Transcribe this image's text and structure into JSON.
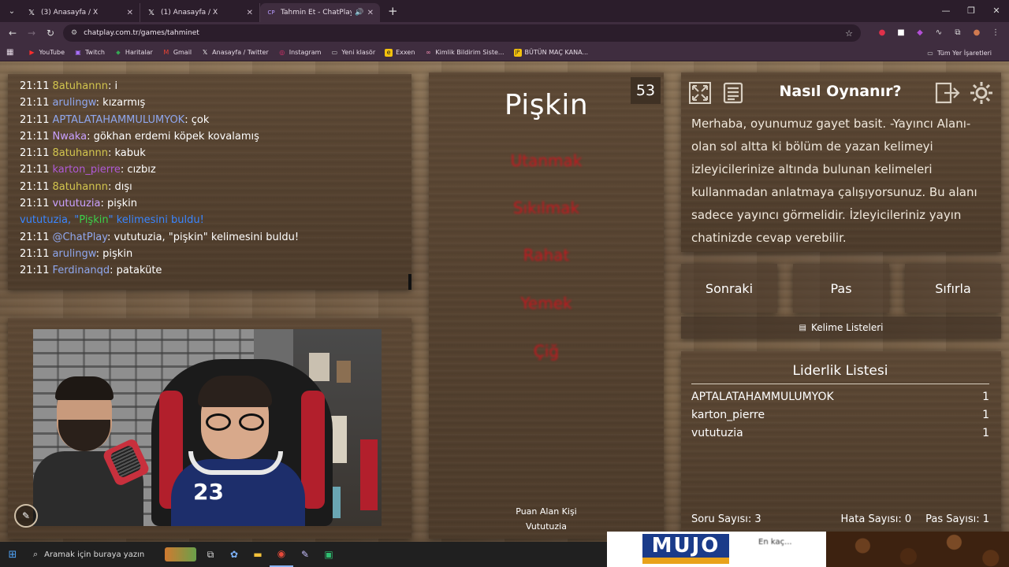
{
  "browser": {
    "tabs": [
      {
        "title": "(3) Anasayfa / X",
        "favicon": "x-logo-icon",
        "active": false
      },
      {
        "title": "(1) Anasayfa / X",
        "favicon": "x-logo-icon",
        "active": false
      },
      {
        "title": "Tahmin Et - ChatPlay",
        "favicon": "chatplay-icon",
        "active": true
      }
    ],
    "url": "chatplay.com.tr/games/tahminet",
    "bookmarks": [
      "YouTube",
      "Twitch",
      "Haritalar",
      "Gmail",
      "Anasayfa / Twitter",
      "Instagram",
      "Yeni klasör",
      "Exxen",
      "Kimlik Bildirim Siste...",
      "BÜTÜN MAÇ KANA..."
    ],
    "bookmarks_all": "Tüm Yer İşaretleri"
  },
  "chat": {
    "messages": [
      {
        "time": "21:11",
        "user": "8atuhannn",
        "color": "#d2c54e",
        "text": "i"
      },
      {
        "time": "21:11",
        "user": "arulingw",
        "color": "#8fa7ee",
        "text": "kızarmış"
      },
      {
        "time": "21:11",
        "user": "APTALATAHAMMULUMYOK",
        "color": "#8fa7ee",
        "text": "çok"
      },
      {
        "time": "21:11",
        "user": "Nwaka",
        "color": "#c9a0ff",
        "text": "gökhan erdemi köpek kovalamış"
      },
      {
        "time": "21:11",
        "user": "8atuhannn",
        "color": "#d2c54e",
        "text": "kabuk"
      },
      {
        "time": "21:11",
        "user": "karton_pierre",
        "color": "#b05ad6",
        "text": "cızbız"
      },
      {
        "time": "21:11",
        "user": "8atuhannn",
        "color": "#d2c54e",
        "text": "dışı"
      },
      {
        "time": "21:11",
        "user": "vututuzia",
        "color": "#c9a0ff",
        "text": "pişkin"
      },
      {
        "time": "21:11",
        "user": "@ChatPlay",
        "color": "#8fa7ee",
        "text": "vututuzia, \"pişkin\" kelimesini buldu!"
      },
      {
        "time": "21:11",
        "user": "arulingw",
        "color": "#8fa7ee",
        "text": "pişkin"
      },
      {
        "time": "21:11",
        "user": "Ferdinanqd",
        "color": "#8fa7ee",
        "text": "pataküte"
      }
    ],
    "system_notice": {
      "prefix": "vututuzia, \"",
      "word": "Pişkin",
      "suffix": "\" kelimesini buldu!"
    }
  },
  "game": {
    "timer": "53",
    "word": "Pişkin",
    "taboo_words": [
      "Utanmak",
      "Sıkılmak",
      "Rahat",
      "Yemek",
      "Çiğ"
    ],
    "scorer_label": "Puan Alan Kişi",
    "scorer_name": "Vututuzia"
  },
  "howto": {
    "title": "Nasıl Oynanır?",
    "text": "Merhaba, oyunumuz gayet basit. -Yayıncı Alanı- olan sol altta ki bölüm de yazan kelimeyi izleyicilerinize altında bulunan kelimeleri kullanmadan anlatmaya çalışıyorsunuz. Bu alanı sadece yayıncı görmelidir. İzleyicileriniz yayın chatinizde cevap verebilir."
  },
  "actions": {
    "next": "Sonraki",
    "pass": "Pas",
    "reset": "Sıfırla",
    "word_lists": "Kelime Listeleri"
  },
  "leaderboard": {
    "title": "Liderlik Listesi",
    "rows": [
      {
        "name": "APTALATAHAMMULUMYOK",
        "score": "1"
      },
      {
        "name": "karton_pierre",
        "score": "1"
      },
      {
        "name": "vututuzia",
        "score": "1"
      }
    ]
  },
  "stats": {
    "questions": "Soru Sayısı: 3",
    "errors": "Hata Sayısı: 0",
    "passes": "Pas Sayısı: 1"
  },
  "ad": {
    "logo": "MUJO",
    "tagline": "En kaç..."
  },
  "taskbar": {
    "search_placeholder": "Aramak için buraya yazın"
  },
  "colors": {
    "taboo": "#c9161e",
    "notice_blue": "#3a86ff",
    "notice_green": "#3bd14a"
  }
}
